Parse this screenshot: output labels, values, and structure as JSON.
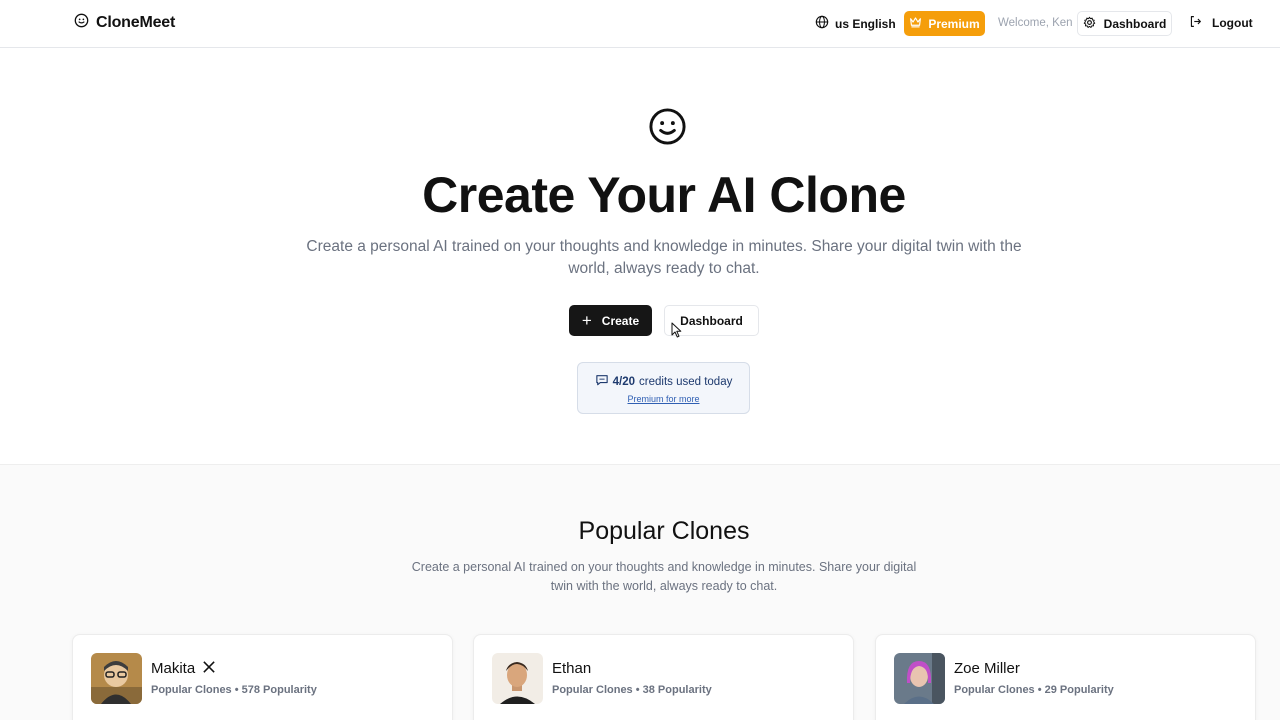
{
  "header": {
    "brand": "CloneMeet",
    "language": "us English",
    "premium_label": "Premium",
    "welcome": "Welcome, Ken",
    "dashboard_label": "Dashboard",
    "logout_label": "Logout"
  },
  "hero": {
    "title": "Create Your AI Clone",
    "subtitle": "Create a personal AI trained on your thoughts and knowledge in minutes. Share your digital twin with the world, always ready to chat.",
    "create_label": "Create",
    "dashboard_label": "Dashboard"
  },
  "credits": {
    "used": "4/20",
    "text": "credits used today",
    "link": "Premium for more"
  },
  "popular": {
    "title": "Popular Clones",
    "subtitle": "Create a personal AI trained on your thoughts and knowledge in minutes. Share your digital twin with the world, always ready to chat.",
    "cards": [
      {
        "name": "Makita",
        "meta": "Popular Clones • 578 Popularity",
        "has_x_icon": true
      },
      {
        "name": "Ethan",
        "meta": "Popular Clones • 38 Popularity",
        "has_x_icon": false
      },
      {
        "name": "Zoe Miller",
        "meta": "Popular Clones • 29 Popularity",
        "has_x_icon": false
      }
    ]
  },
  "colors": {
    "premium": "#f59e0b",
    "primary_button": "#161616",
    "credits_bg": "#f3f6fb",
    "link": "#2f5fb3"
  },
  "icons": [
    "smile-logo-icon",
    "globe-icon",
    "crown-icon",
    "gear-icon",
    "logout-icon",
    "plus-icon",
    "chat-icon",
    "x-icon",
    "cursor-icon"
  ]
}
